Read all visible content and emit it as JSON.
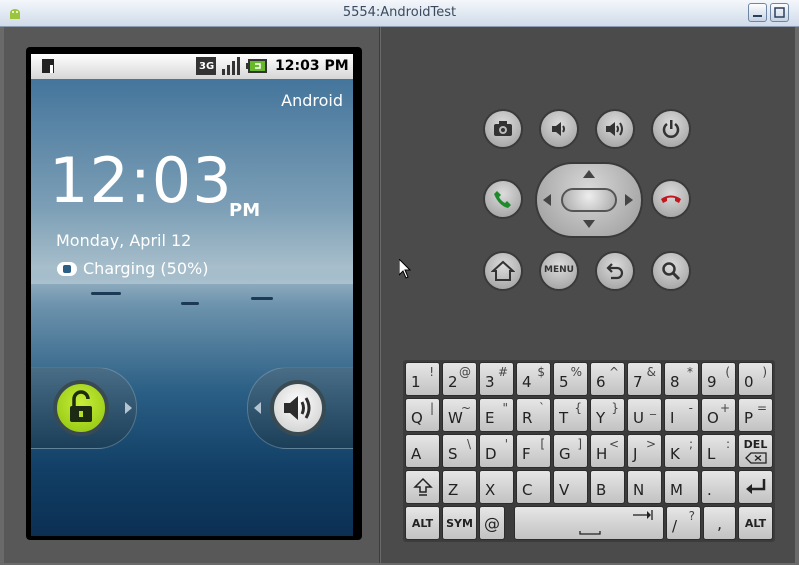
{
  "window": {
    "title": "5554:AndroidTest"
  },
  "status_bar": {
    "time": "12:03 PM",
    "network": "3G"
  },
  "lockscreen": {
    "carrier": "Android",
    "clock_time": "12:03",
    "ampm": "PM",
    "date": "Monday, April 12",
    "charging": "Charging (50%)"
  },
  "controls": {
    "menu_label": "MENU"
  },
  "keyboard": {
    "row1": [
      {
        "main": "1",
        "alt": "!"
      },
      {
        "main": "2",
        "alt": "@"
      },
      {
        "main": "3",
        "alt": "#"
      },
      {
        "main": "4",
        "alt": "$"
      },
      {
        "main": "5",
        "alt": "%"
      },
      {
        "main": "6",
        "alt": "^"
      },
      {
        "main": "7",
        "alt": "&"
      },
      {
        "main": "8",
        "alt": "*"
      },
      {
        "main": "9",
        "alt": "("
      },
      {
        "main": "0",
        "alt": ")"
      }
    ],
    "row2": [
      {
        "main": "Q",
        "alt": "|"
      },
      {
        "main": "W",
        "alt": "~"
      },
      {
        "main": "E",
        "alt": "\""
      },
      {
        "main": "R",
        "alt": "`"
      },
      {
        "main": "T",
        "alt": "{"
      },
      {
        "main": "Y",
        "alt": "}"
      },
      {
        "main": "U",
        "alt": "_"
      },
      {
        "main": "I",
        "alt": "-"
      },
      {
        "main": "O",
        "alt": "+"
      },
      {
        "main": "P",
        "alt": "="
      }
    ],
    "row3": [
      {
        "main": "A",
        "alt": ""
      },
      {
        "main": "S",
        "alt": "\\"
      },
      {
        "main": "D",
        "alt": "'"
      },
      {
        "main": "F",
        "alt": "["
      },
      {
        "main": "G",
        "alt": "]"
      },
      {
        "main": "H",
        "alt": "<"
      },
      {
        "main": "J",
        "alt": ">"
      },
      {
        "main": "K",
        "alt": ";"
      },
      {
        "main": "L",
        "alt": ":"
      }
    ],
    "row4": [
      {
        "main": "Z",
        "alt": ""
      },
      {
        "main": "X",
        "alt": ""
      },
      {
        "main": "C",
        "alt": ""
      },
      {
        "main": "V",
        "alt": ""
      },
      {
        "main": "B",
        "alt": ""
      },
      {
        "main": "N",
        "alt": ""
      },
      {
        "main": "M",
        "alt": ""
      },
      {
        "main": ".",
        "alt": ""
      }
    ],
    "del_label": "DEL",
    "alt_label": "ALT",
    "sym_label": "SYM",
    "at_label": "@",
    "slash_main": "/",
    "slash_alt": "?",
    "comma_main": ",",
    "comma_alt": ""
  }
}
